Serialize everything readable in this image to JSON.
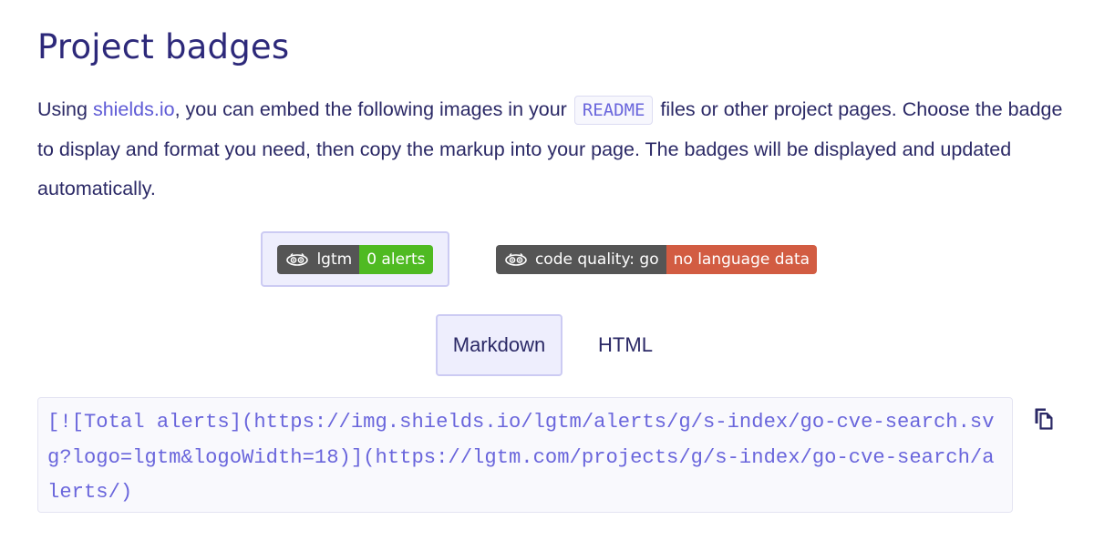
{
  "title": "Project badges",
  "intro": {
    "text_before_link": "Using ",
    "link_text": "shields.io",
    "text_after_link": ", you can embed the following images in your ",
    "code_term": "README",
    "text_end": " files or other project pages. Choose the badge to display and format you need, then copy the markup into your page. The badges will be displayed and updated automatically."
  },
  "badges": [
    {
      "label": "lgtm",
      "value": "0 alerts",
      "value_color": "#4fba22",
      "logo": "lgtm-logo-icon",
      "selected": true
    },
    {
      "label": "code quality: go",
      "value": "no language data",
      "value_color": "#d25c42",
      "logo": "lgtm-logo-icon",
      "selected": false
    }
  ],
  "tabs": [
    {
      "label": "Markdown",
      "active": true
    },
    {
      "label": "HTML",
      "active": false
    }
  ],
  "code": {
    "markup": "[![Total alerts](https://img.shields.io/lgtm/alerts/g/s-index/go-cve-search.svg?logo=lgtm&logoWidth=18)](https://lgtm.com/projects/g/s-index/go-cve-search/alerts/)",
    "copy_icon": "copy-icon"
  },
  "colors": {
    "accent": "#6a66dc",
    "text": "#2b2966",
    "selected_bg": "#eeeefd",
    "selected_border": "#cccbf3",
    "badge_label_bg": "#555555"
  }
}
